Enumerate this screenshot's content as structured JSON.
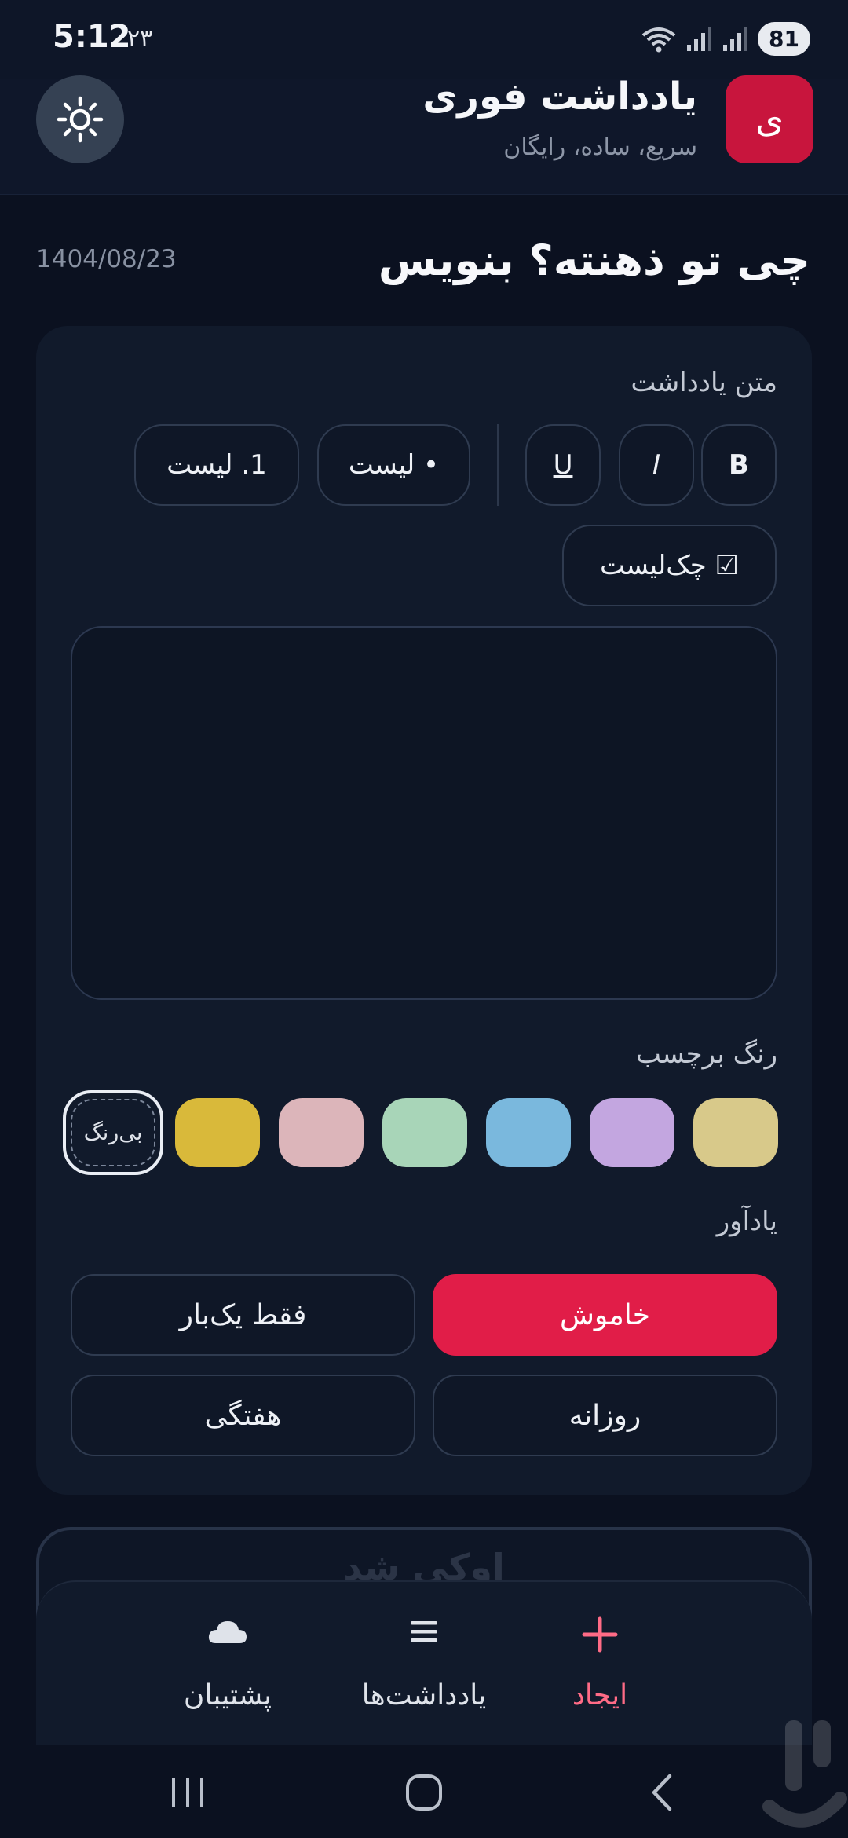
{
  "status_bar": {
    "time": "5:12",
    "extra": "۲۳",
    "battery": "81"
  },
  "header": {
    "logo_letter": "ی",
    "title": "یادداشت فوری",
    "subtitle": "سریع، ساده، رایگان"
  },
  "page": {
    "title": "چی تو ذهنته؟ بنویس",
    "date": "1404/08/23"
  },
  "editor": {
    "label": "متن یادداشت",
    "format_buttons": {
      "bold": "B",
      "italic": "I",
      "underline": "U",
      "bullet_list": "• لیست",
      "numbered_list": "1. لیست",
      "checklist": "☑ چک‌لیست"
    },
    "content": ""
  },
  "colors": {
    "label": "رنگ برچسب",
    "none_label": "بی‌رنگ",
    "selected": "none",
    "swatches": [
      "#d8c98a",
      "#c3a6e0",
      "#7ab8dd",
      "#a8d5b8",
      "#dcb5ba",
      "#d9b93a"
    ]
  },
  "reminder": {
    "label": "یادآور",
    "options": {
      "off": "خاموش",
      "once": "فقط یک‌بار",
      "daily": "روزانه",
      "weekly": "هفتگی"
    },
    "selected": "off"
  },
  "peek_card": {
    "text": "اوکی شد"
  },
  "bottom_nav": {
    "create": "ایجاد",
    "notes": "یادداشت‌ها",
    "support": "پشتیبان"
  },
  "theme": {
    "accent": "#e11d48",
    "background": "#0b1120",
    "card": "#111a2b"
  }
}
